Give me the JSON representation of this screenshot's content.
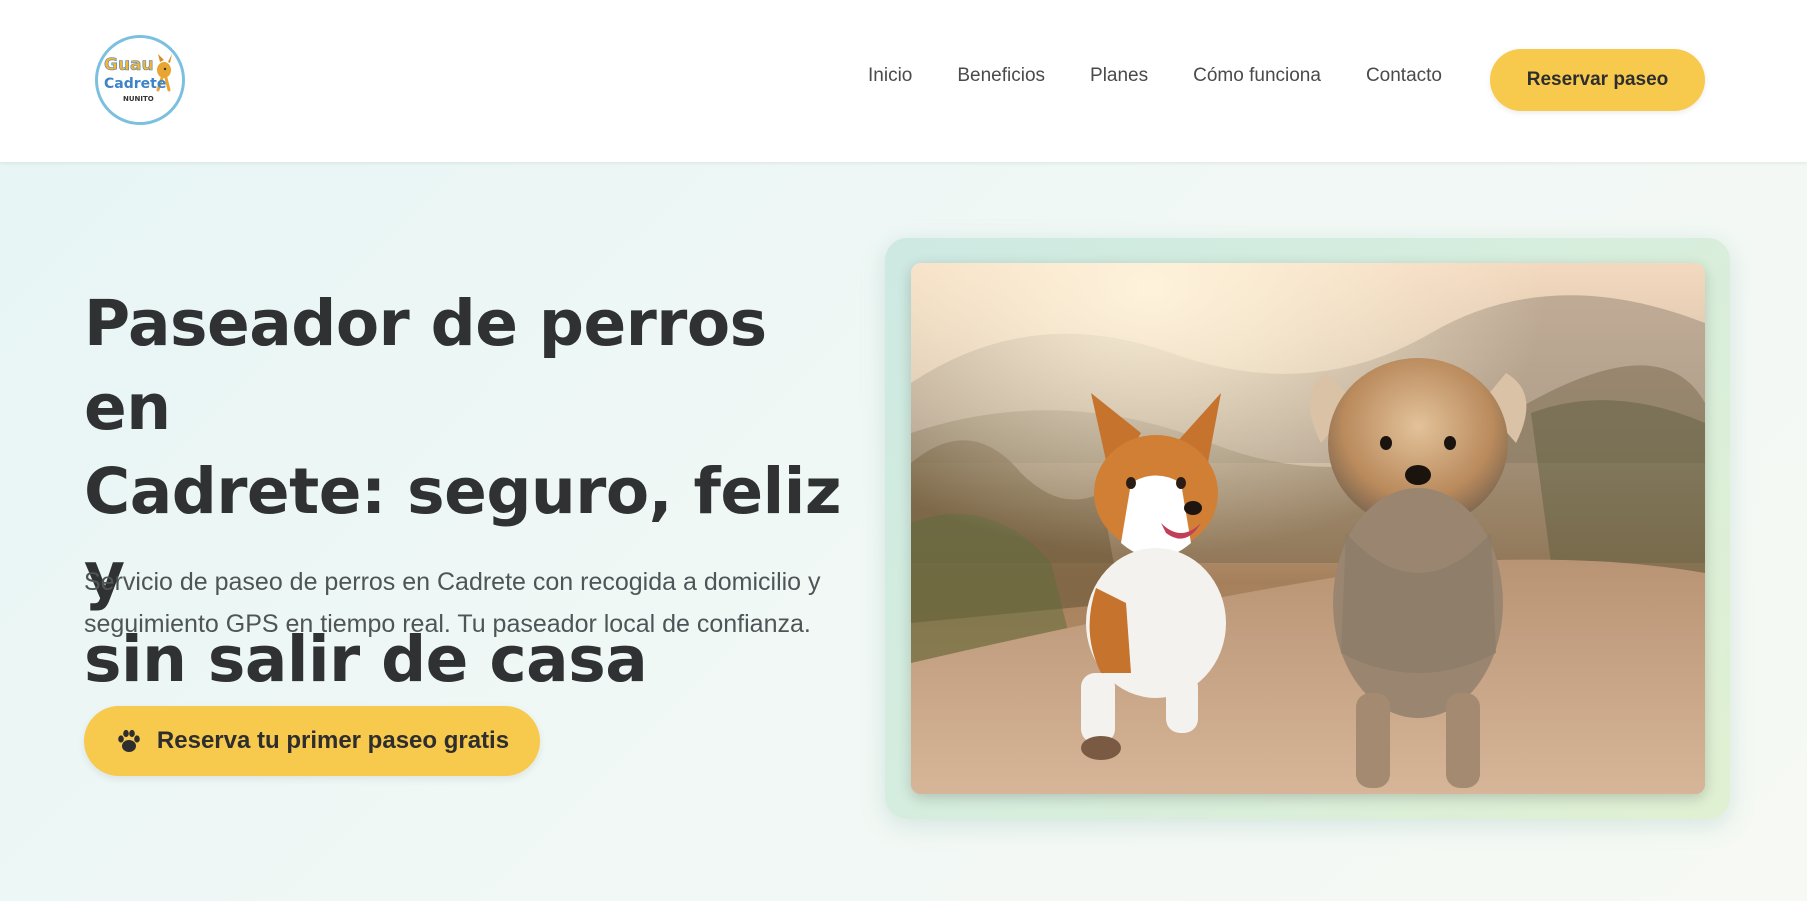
{
  "header": {
    "logo": {
      "text_top": "Guau",
      "text_middle": "Cadrete",
      "text_bottom": "NUNITO"
    },
    "nav": [
      {
        "label": "Inicio"
      },
      {
        "label": "Beneficios"
      },
      {
        "label": "Planes"
      },
      {
        "label": "Cómo funciona"
      },
      {
        "label": "Contacto"
      }
    ],
    "cta_label": "Reservar paseo"
  },
  "hero": {
    "title_lines": [
      "Paseador de perros en",
      "Cadrete: seguro, feliz y",
      "sin salir de casa"
    ],
    "subtitle_lines": [
      "Servicio de paseo de perros en Cadrete con recogida a domicilio y",
      "seguimiento GPS en tiempo real. Tu paseador local de confianza."
    ],
    "cta_label": "Reserva tu primer paseo gratis",
    "cta_icon": "paw-icon",
    "image_subject": "two-dogs-running-photo"
  },
  "colors": {
    "accent_yellow": "#f7c94c",
    "text_dark": "#2f3133",
    "hero_bg": "#eef7f4",
    "logo_ring": "#7cc0e0"
  }
}
